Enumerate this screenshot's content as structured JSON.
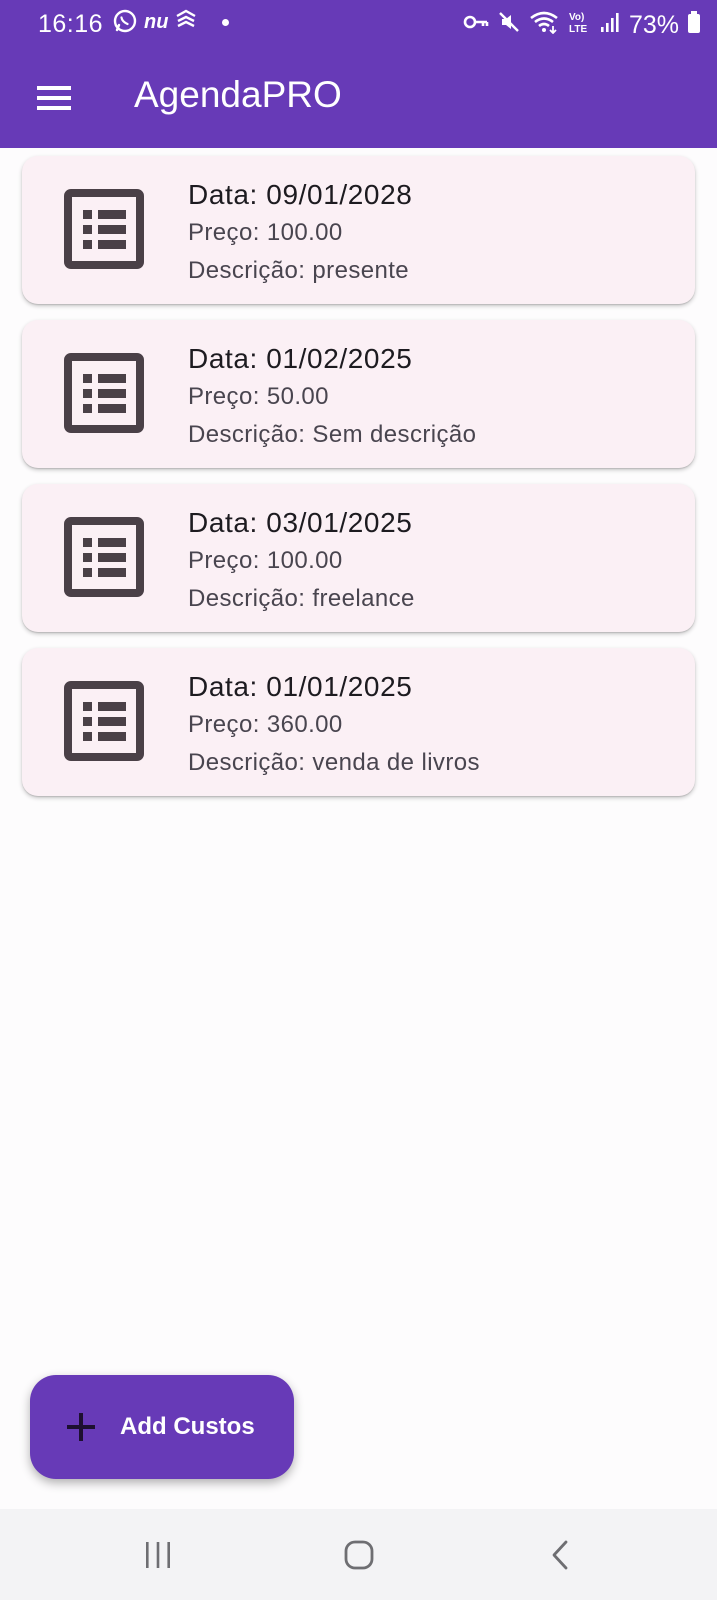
{
  "status_bar": {
    "time": "16:16",
    "left_icons": [
      "whatsapp-icon",
      "nubank-icon",
      "bank-icon",
      "notification-dot"
    ],
    "nu_label": "nu",
    "right_icons": [
      "vpn-key-icon",
      "mute-icon",
      "wifi-icon",
      "volte-icon",
      "signal-icon",
      "battery-icon"
    ],
    "battery": "73%"
  },
  "app_bar": {
    "title": "AgendaPRO",
    "menu_icon": "menu-icon",
    "background": "#673ab7"
  },
  "entries": [
    {
      "date": "Data: 09/01/2028",
      "price": "Preço: 100.00",
      "description": "Descrição: presente"
    },
    {
      "date": "Data: 01/02/2025",
      "price": "Preço: 50.00",
      "description": "Descrição: Sem descrição"
    },
    {
      "date": "Data: 03/01/2025",
      "price": "Preço: 100.00",
      "description": "Descrição: freelance"
    },
    {
      "date": "Data: 01/01/2025",
      "price": "Preço: 360.00",
      "description": "Descrição: venda de livros"
    }
  ],
  "fab": {
    "label": "Add Custos",
    "icon": "plus-icon"
  },
  "nav_bar": {
    "buttons": [
      "recent-apps-icon",
      "home-icon",
      "back-icon"
    ]
  },
  "colors": {
    "primary": "#673ab7",
    "card_background": "#fbf0f5",
    "icon_color": "#4a4047"
  }
}
